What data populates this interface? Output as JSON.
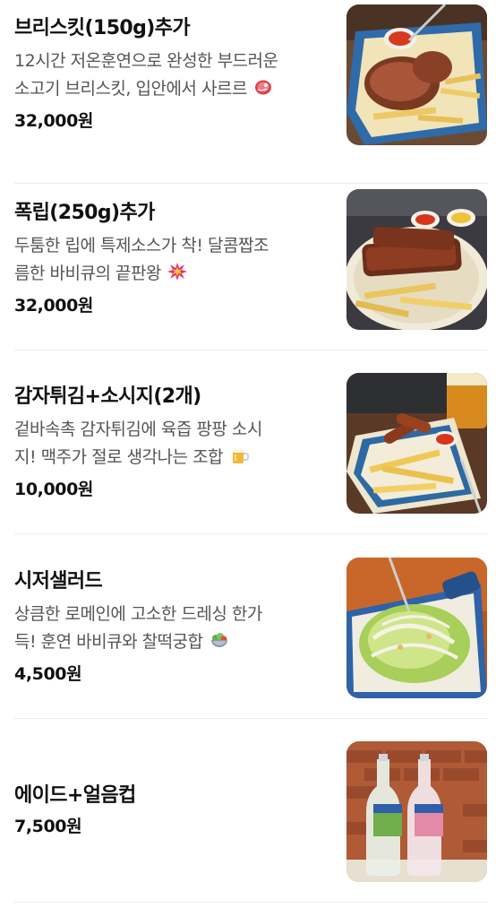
{
  "menu": {
    "items": [
      {
        "name": "브리스킷(150g)추가",
        "desc_line1": "12시간 저온훈연으로 완성한 부드러운",
        "desc_line2": "소고기 브리스킷, 입안에서 사르르",
        "emoji_icon": "meat-icon",
        "price": "32,000",
        "currency": "원"
      },
      {
        "name": "폭립(250g)추가",
        "desc_line1": "두툼한 립에 특제소스가 착! 달콤짭조",
        "desc_line2": "름한 바비큐의 끝판왕",
        "emoji_icon": "explosion-icon",
        "price": "32,000",
        "currency": "원"
      },
      {
        "name": "감자튀김+소시지(2개)",
        "desc_line1": "겉바속촉 감자튀김에 육즙 팡팡 소시",
        "desc_line2": "지! 맥주가 절로 생각나는 조합",
        "emoji_icon": "beer-mug-icon",
        "price": "10,000",
        "currency": "원"
      },
      {
        "name": "시저샐러드",
        "desc_line1": "상큼한 로메인에 고소한 드레싱 한가",
        "desc_line2": "득! 훈연 바비큐와 찰떡궁합",
        "emoji_icon": "salad-bowl-icon",
        "price": "4,500",
        "currency": "원"
      },
      {
        "name": "에이드+얼음컵",
        "price": "7,500",
        "currency": "원"
      }
    ]
  },
  "colors": {
    "text_primary": "#111111",
    "text_secondary": "#555555",
    "divider": "#ececec"
  }
}
